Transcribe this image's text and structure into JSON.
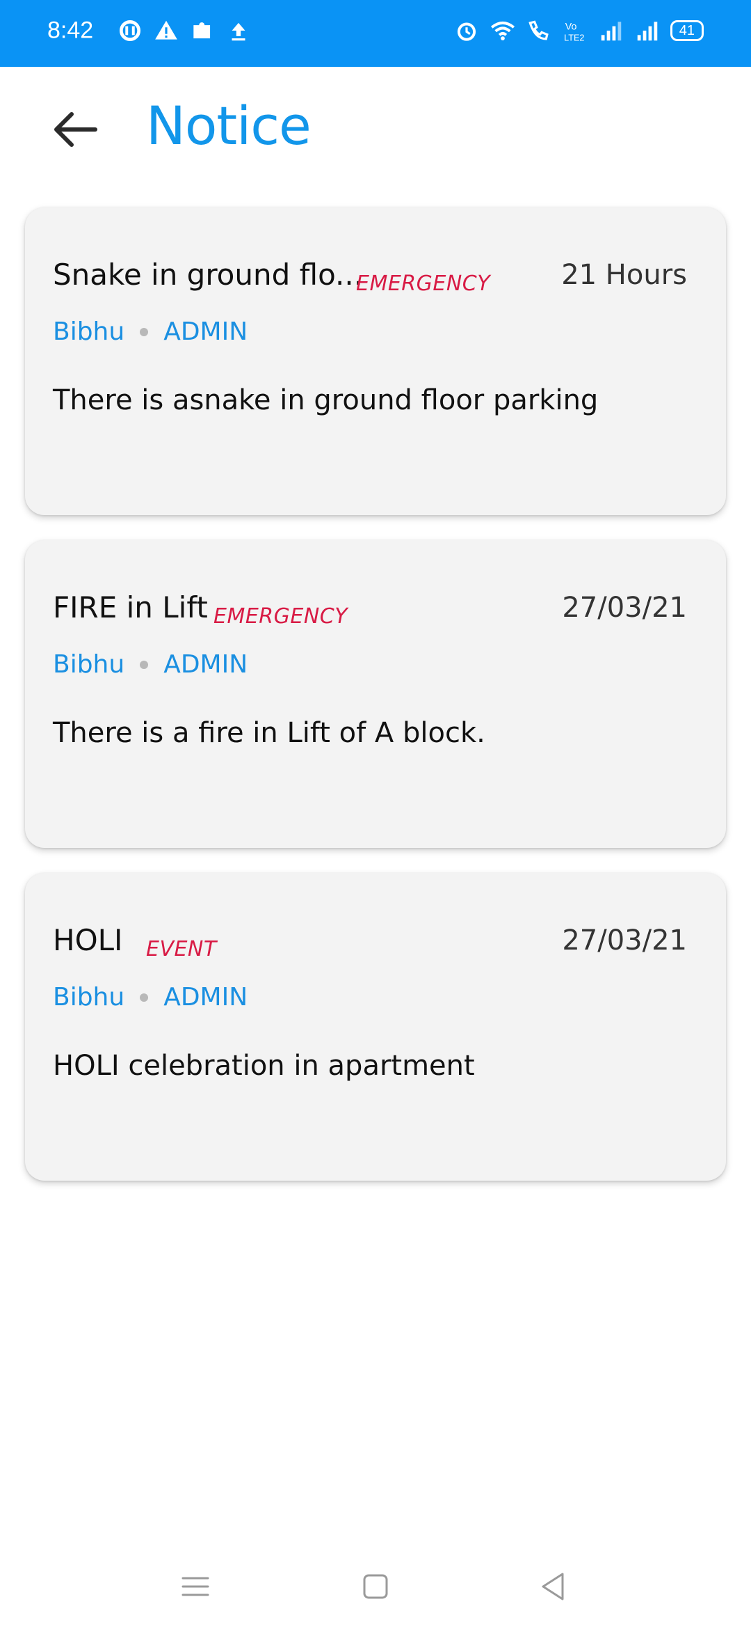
{
  "status_bar": {
    "time": "8:42",
    "battery": "41",
    "bg_color": "#0a93f5",
    "left_icons": [
      "sync-icon",
      "warning-icon",
      "puzzle-icon",
      "upload-icon"
    ],
    "right_icons": [
      "alarm-icon",
      "wifi-icon",
      "wifi-calling-icon",
      "volte-icon",
      "signal-icon",
      "signal-icon"
    ]
  },
  "header": {
    "title": "Notice",
    "title_color": "#1296ea"
  },
  "notices": [
    {
      "title": "Snake in ground flo...",
      "tag": "EMERGENCY",
      "time": "21 Hours",
      "author": "Bibhu",
      "role": "ADMIN",
      "body": "There is asnake in ground floor parking"
    },
    {
      "title": "FIRE in Lift",
      "tag": "EMERGENCY",
      "time": "27/03/21",
      "author": "Bibhu",
      "role": "ADMIN",
      "body": "There is a fire in Lift of A block."
    },
    {
      "title": "HOLI",
      "tag": "EVENT",
      "time": "27/03/21",
      "author": "Bibhu",
      "role": "ADMIN",
      "body": "HOLI celebration in apartment"
    }
  ],
  "colors": {
    "tag": "#d81b45",
    "meta": "#1a8fe1",
    "card_bg": "#f3f3f3"
  }
}
